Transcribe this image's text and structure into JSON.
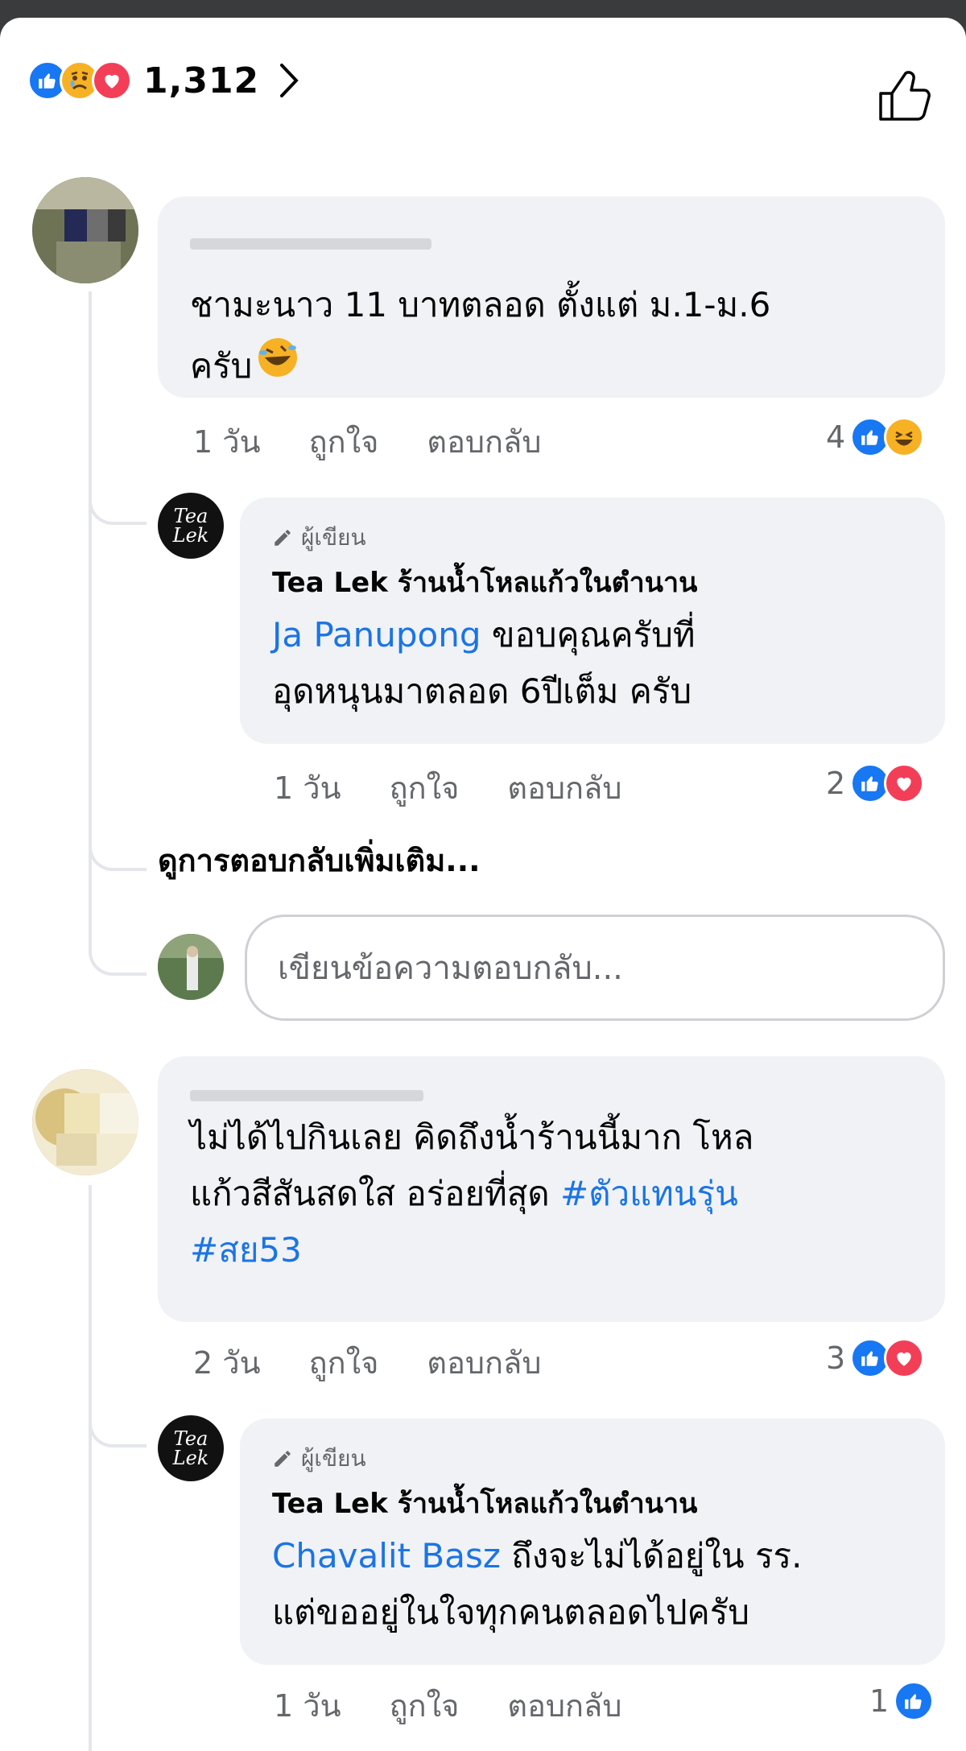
{
  "reactions_summary": {
    "icons": [
      "like-icon",
      "sad-icon",
      "love-icon"
    ],
    "count": "1,312"
  },
  "comments": [
    {
      "author": "Ja Panupong",
      "text_lines": [
        "ชามะนาว 11 บาทตลอด ตั้งแต่ ม.1-ม.6",
        "ครับ"
      ],
      "emoji": "laughing-emoji",
      "time": "1 วัน",
      "like_label": "ถูกใจ",
      "reply_label": "ตอบกลับ",
      "reaction_count": "4",
      "reaction_icons": [
        "like-icon",
        "haha-icon"
      ],
      "reply": {
        "badge": "ผู้เขียน",
        "page_name": "Tea Lek ร้านน้ำโหลแก้วในตำนาน",
        "mention": "Ja Panupong",
        "line1_rest": " ขอบคุณครับที่",
        "line2": "อุดหนุนมาตลอด 6ปีเต็ม ครับ",
        "time": "1 วัน",
        "like_label": "ถูกใจ",
        "reply_label": "ตอบกลับ",
        "reaction_count": "2",
        "reaction_icons": [
          "like-icon",
          "love-icon"
        ]
      },
      "more_replies": "ดูการตอบกลับเพิ่มเติม...",
      "reply_placeholder": "เขียนข้อความตอบกลับ..."
    },
    {
      "author": "Chavalit Basz",
      "line1": "ไม่ได้ไปกินเลย คิดถึงน้ำร้านนี้มาก โหล",
      "line2_text": "แก้วสีสันสดใส อร่อยที่สุด ",
      "hashtag1": "#ตัวแทนรุ่น",
      "hashtag2": "#สย53",
      "time": "2 วัน",
      "like_label": "ถูกใจ",
      "reply_label": "ตอบกลับ",
      "reaction_count": "3",
      "reaction_icons": [
        "like-icon",
        "love-icon"
      ],
      "reply": {
        "badge": "ผู้เขียน",
        "page_name": "Tea Lek ร้านน้ำโหลแก้วในตำนาน",
        "mention": "Chavalit Basz",
        "line1_rest": " ถึงจะไม่ได้อยู่ใน รร.",
        "line2": "แต่ขออยู่ในใจทุกคนตลอดไปครับ",
        "time": "1 วัน",
        "like_label": "ถูกใจ",
        "reply_label": "ตอบกลับ",
        "reaction_count": "1",
        "reaction_icons": [
          "like-icon"
        ]
      }
    }
  ],
  "page_avatar_text": [
    "Tea",
    "Lek"
  ],
  "colors": {
    "like": "#1877f2",
    "love": "#f33e58",
    "haha": "#f7b125",
    "link": "#1b74e4",
    "bubble": "#f0f2f5"
  }
}
